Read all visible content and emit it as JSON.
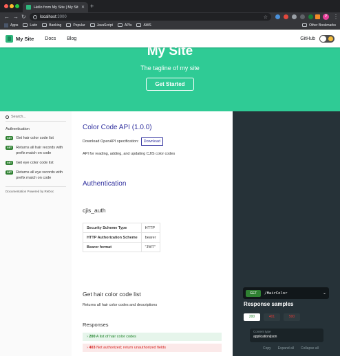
{
  "browser": {
    "tab_title": "Hello from My Site | My Site",
    "url_host": "localhost",
    "url_port": ":3000",
    "profile_initial": "P",
    "bookmarks": [
      "Apps",
      "Latin",
      "Banking",
      "Popular",
      "JavaScript",
      "APIs",
      "AWS"
    ],
    "other_bookmarks": "Other Bookmarks"
  },
  "site_nav": {
    "brand": "My Site",
    "links": [
      "Docs",
      "Blog"
    ],
    "github": "GitHub"
  },
  "hero": {
    "title": "My Site",
    "tagline": "The tagline of my site",
    "cta": "Get Started",
    "color": "#2fcb95"
  },
  "sidebar": {
    "search_placeholder": "Search...",
    "heading": "Authentication",
    "badge": "GET",
    "items": [
      "Get hair color code list",
      "Returns all hair records with prefix match on code",
      "Get eye color code list",
      "Returns all eye records with prefix match on code"
    ],
    "footer": "Documentation Powered by ReDoc"
  },
  "main": {
    "api_title": "Color Code API (1.0.0)",
    "spec_label": "Download OpenAPI specification:",
    "download": "Download",
    "description": "API for reading, adding, and updating CJIS color codes",
    "auth_heading": "Authentication",
    "scheme_name": "cjis_auth",
    "scheme_rows": [
      [
        "Security Scheme Type",
        "HTTP"
      ],
      [
        "HTTP Authorization Scheme",
        "bearer"
      ],
      [
        "Bearer format",
        "\"JWT\""
      ]
    ],
    "op_title": "Get hair color code list",
    "op_desc": "Returns all hair color codes and descriptions",
    "responses_heading": "Responses",
    "responses": [
      {
        "code": "200",
        "text": "A list of hair color codes"
      },
      {
        "code": "403",
        "text": "Not authorized; return unauthorized fields"
      }
    ]
  },
  "right_panel": {
    "method": "GET",
    "path": "/HairColor",
    "samples_heading": "Response samples",
    "codes": [
      "200",
      "401",
      "500"
    ],
    "content_type_label": "Content type",
    "content_type_value": "application/json",
    "actions": [
      "Copy",
      "Expand all",
      "Collapse all"
    ]
  }
}
